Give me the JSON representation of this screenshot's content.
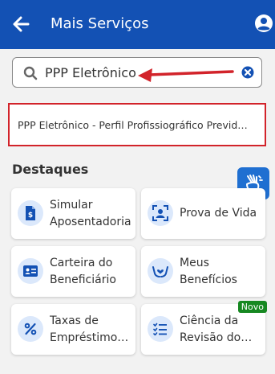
{
  "header": {
    "title": "Mais Serviços",
    "background": "#1351b4"
  },
  "search": {
    "value": "PPP Eletrônico"
  },
  "suggestion": {
    "text": "PPP Eletrônico - Perfil Profissiográfico Previd…",
    "highlight_color": "#d2232a"
  },
  "section": {
    "title": "Destaques"
  },
  "cards": [
    {
      "label": "Simular Aposentadoria",
      "icon": "document-dollar-icon"
    },
    {
      "label": "Prova de Vida",
      "icon": "face-scan-icon"
    },
    {
      "label": "Carteira do Beneficiário",
      "icon": "id-card-icon"
    },
    {
      "label": "Meus Benefícios",
      "icon": "hands-heart-icon"
    },
    {
      "label": "Taxas de Empréstimo…",
      "icon": "percent-icon"
    },
    {
      "label": "Ciência da Revisão do…",
      "icon": "checklist-icon",
      "badge": "Novo"
    }
  ],
  "accent_color": "#1351b4",
  "badge_color": "#168821"
}
